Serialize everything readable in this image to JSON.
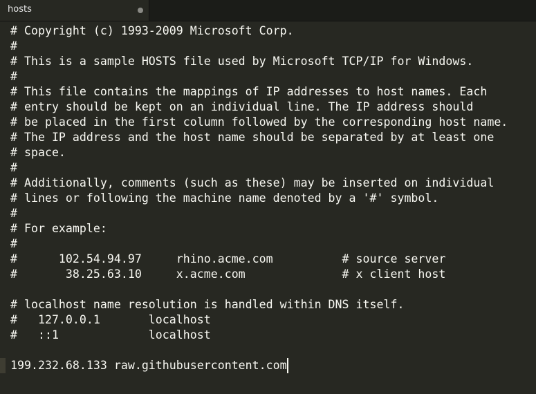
{
  "tab": {
    "title": "hosts"
  },
  "editor": {
    "lines": [
      "# Copyright (c) 1993-2009 Microsoft Corp.",
      "#",
      "# This is a sample HOSTS file used by Microsoft TCP/IP for Windows.",
      "#",
      "# This file contains the mappings of IP addresses to host names. Each",
      "# entry should be kept on an individual line. The IP address should",
      "# be placed in the first column followed by the corresponding host name.",
      "# The IP address and the host name should be separated by at least one",
      "# space.",
      "#",
      "# Additionally, comments (such as these) may be inserted on individual",
      "# lines or following the machine name denoted by a '#' symbol.",
      "#",
      "# For example:",
      "#",
      "#      102.54.94.97     rhino.acme.com          # source server",
      "#       38.25.63.10     x.acme.com              # x client host",
      "",
      "# localhost name resolution is handled within DNS itself.",
      "#   127.0.0.1       localhost",
      "#   ::1             localhost",
      "",
      "199.232.68.133 raw.githubusercontent.com"
    ]
  }
}
